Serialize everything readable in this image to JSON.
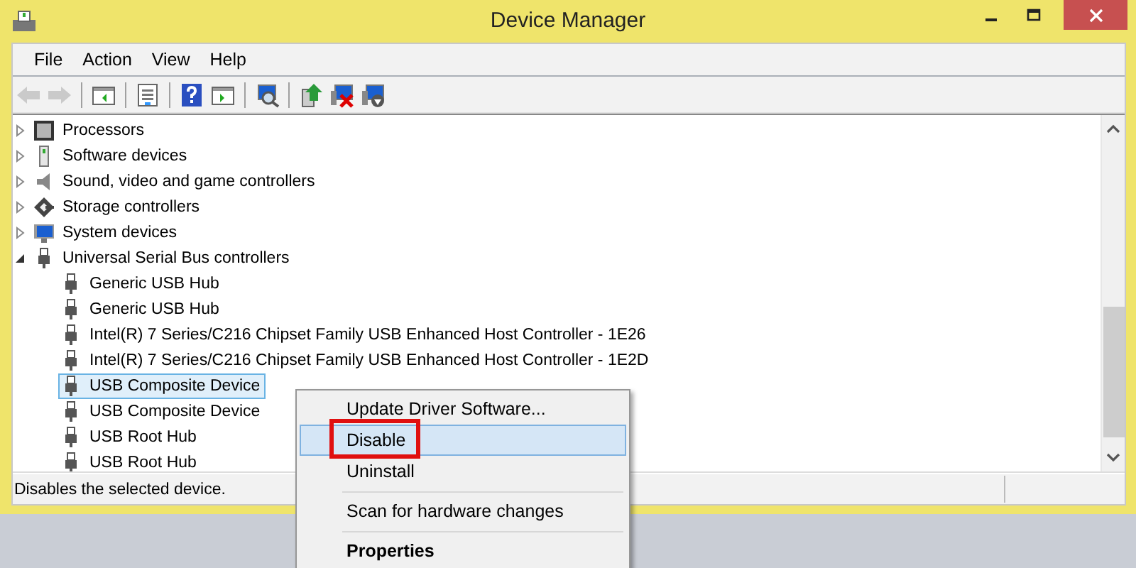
{
  "window": {
    "title": "Device Manager"
  },
  "menu_bar": [
    {
      "label": "File"
    },
    {
      "label": "Action"
    },
    {
      "label": "View"
    },
    {
      "label": "Help"
    }
  ],
  "toolbar": [
    [
      {
        "kind": "back",
        "disabled": true
      },
      {
        "kind": "forward",
        "disabled": true
      }
    ],
    [
      {
        "kind": "console-tree",
        "disabled": false
      }
    ],
    [
      {
        "kind": "properties",
        "disabled": false
      }
    ],
    [
      {
        "kind": "help",
        "disabled": false
      },
      {
        "kind": "action-pane",
        "disabled": false
      }
    ],
    [
      {
        "kind": "scan",
        "disabled": false
      }
    ],
    [
      {
        "kind": "update",
        "disabled": false
      },
      {
        "kind": "disable",
        "disabled": false
      },
      {
        "kind": "uninstall",
        "disabled": false
      }
    ]
  ],
  "tree": [
    {
      "label": "Processors",
      "kind": "processor",
      "expanded": false,
      "selected": false
    },
    {
      "label": "Software devices",
      "kind": "software",
      "expanded": false,
      "selected": false
    },
    {
      "label": "Sound, video and game controllers",
      "kind": "sound",
      "expanded": false,
      "selected": false
    },
    {
      "label": "Storage controllers",
      "kind": "storage",
      "expanded": false,
      "selected": false
    },
    {
      "label": "System devices",
      "kind": "system",
      "expanded": false,
      "selected": false
    },
    {
      "label": "Universal Serial Bus controllers",
      "kind": "usb",
      "expanded": true,
      "selected": false,
      "children": [
        {
          "label": "Generic USB Hub",
          "kind": "usb",
          "selected": false
        },
        {
          "label": "Generic USB Hub",
          "kind": "usb",
          "selected": false
        },
        {
          "label": "Intel(R) 7 Series/C216 Chipset Family USB Enhanced Host Controller - 1E26",
          "kind": "usb",
          "selected": false
        },
        {
          "label": "Intel(R) 7 Series/C216 Chipset Family USB Enhanced Host Controller - 1E2D",
          "kind": "usb",
          "selected": false
        },
        {
          "label": "USB Composite Device",
          "kind": "usb",
          "selected": true
        },
        {
          "label": "USB Composite Device",
          "kind": "usb",
          "selected": false
        },
        {
          "label": "USB Root Hub",
          "kind": "usb",
          "selected": false
        },
        {
          "label": "USB Root Hub",
          "kind": "usb",
          "selected": false
        }
      ]
    }
  ],
  "status_bar": {
    "text": "Disables the selected device."
  },
  "context_menu": [
    {
      "kind": "item",
      "label": "Update Driver Software...",
      "selected": false,
      "marked": false
    },
    {
      "kind": "item",
      "label": "Disable",
      "selected": true,
      "marked": true
    },
    {
      "kind": "item",
      "label": "Uninstall",
      "selected": false,
      "marked": false
    },
    {
      "kind": "separator"
    },
    {
      "kind": "item",
      "label": "Scan for hardware changes",
      "selected": false,
      "marked": false
    },
    {
      "kind": "separator"
    },
    {
      "kind": "default",
      "label": "Properties",
      "selected": false,
      "marked": false
    }
  ]
}
